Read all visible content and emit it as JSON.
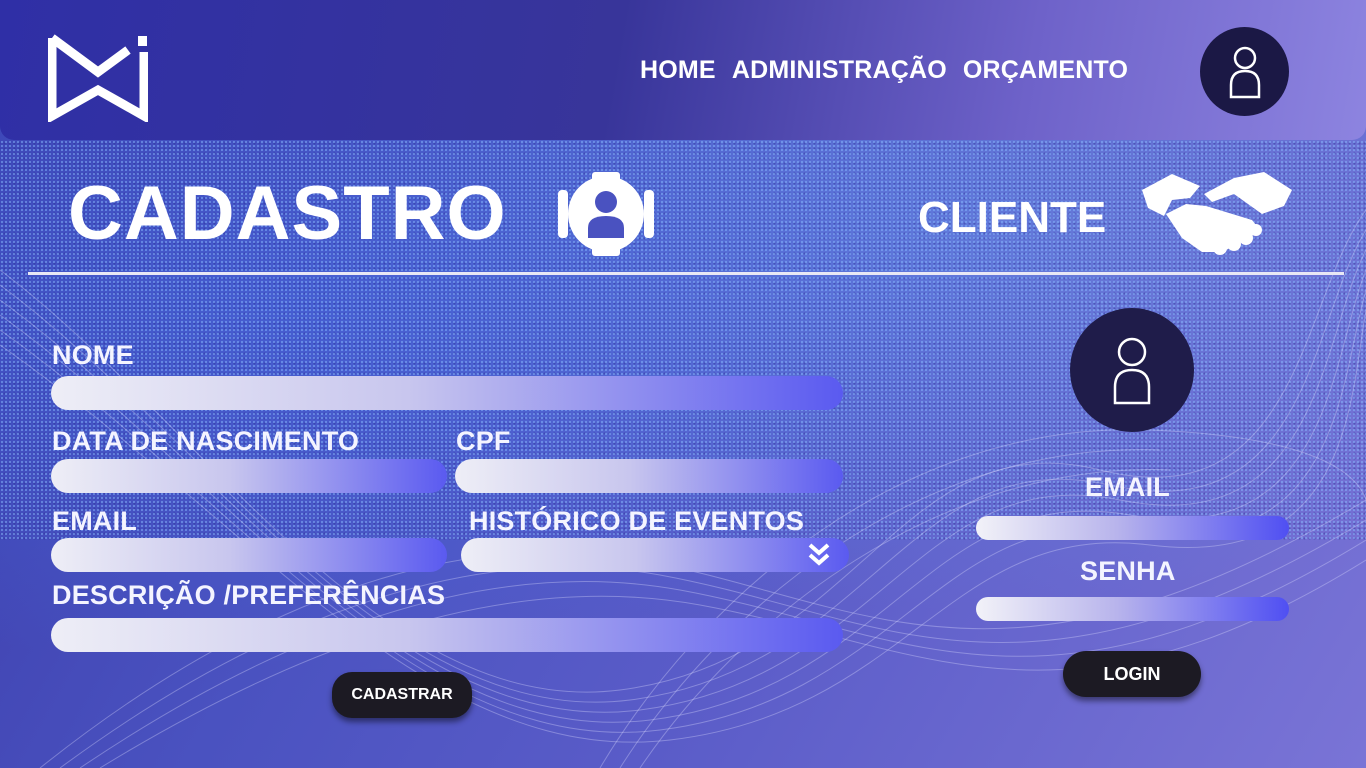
{
  "nav": {
    "items": [
      "HOME",
      "ADMINISTRAÇÃO",
      "ORÇAMENTO"
    ]
  },
  "page": {
    "title": "CADASTRO",
    "subtitle": "CLIENTE"
  },
  "form": {
    "nome_label": "NOME",
    "nome_value": "",
    "data_nascimento_label": "DATA DE NASCIMENTO",
    "data_nascimento_value": "",
    "cpf_label": "CPF",
    "cpf_value": "",
    "email_label": "EMAIL",
    "email_value": "",
    "historico_label": "HISTÓRICO DE EVENTOS",
    "historico_value": "",
    "descricao_label": "DESCRIÇÃO /PREFERÊNCIAS",
    "descricao_value": "",
    "submit_label": "CADASTRAR"
  },
  "login": {
    "email_label": "EMAIL",
    "email_value": "",
    "senha_label": "SENHA",
    "senha_value": "",
    "submit_label": "LOGIN"
  },
  "icons": {
    "logo": "brand-logo-icon",
    "top_avatar": "user-icon",
    "title_icon": "user-gear-icon",
    "cliente_icon": "handshake-icon",
    "login_avatar": "user-icon",
    "dropdown": "double-chevron-down-icon"
  },
  "colors": {
    "header_start": "#2f2fa6",
    "header_end": "#8d84e0",
    "avatar_bg": "#1b1845",
    "button_bg": "#1c1a23",
    "field_end": "#5a5af0"
  }
}
